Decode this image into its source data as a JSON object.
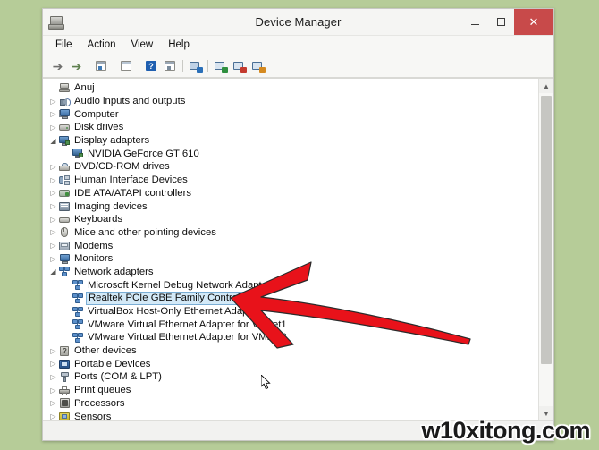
{
  "window": {
    "title": "Device Manager",
    "app_icon": "device-manager-icon",
    "minimize_label": "–",
    "maximize_label": "□",
    "close_label": "✕"
  },
  "menubar": {
    "items": [
      {
        "label": "File"
      },
      {
        "label": "Action"
      },
      {
        "label": "View"
      },
      {
        "label": "Help"
      }
    ]
  },
  "toolbar": {
    "buttons": [
      {
        "name": "back-button",
        "icon": "arrow-left-icon",
        "glyph": "←"
      },
      {
        "name": "forward-button",
        "icon": "arrow-right-icon",
        "glyph": "→"
      },
      {
        "name": "properties-button",
        "icon": "properties-window-icon",
        "glyph": ""
      },
      {
        "name": "help-topics-button",
        "icon": "document-icon",
        "glyph": ""
      },
      {
        "name": "help-button",
        "icon": "question-mark-icon",
        "glyph": "?"
      },
      {
        "name": "show-hidden-devices-button",
        "icon": "monitor-list-icon",
        "glyph": ""
      },
      {
        "name": "scan-hardware-changes-button",
        "icon": "scan-monitor-icon",
        "glyph": ""
      },
      {
        "name": "update-driver-button",
        "icon": "update-driver-icon",
        "glyph": ""
      },
      {
        "name": "uninstall-device-button",
        "icon": "uninstall-device-icon",
        "glyph": ""
      },
      {
        "name": "disable-device-button",
        "icon": "disable-device-icon",
        "glyph": ""
      }
    ]
  },
  "tree": {
    "root": {
      "label": "Anuj",
      "icon": "computer-root-icon",
      "expanded": true
    },
    "nodes": [
      {
        "label": "Audio inputs and outputs",
        "icon": "speaker-icon",
        "state": "collapsed",
        "depth": 1
      },
      {
        "label": "Computer",
        "icon": "computer-icon",
        "state": "collapsed",
        "depth": 1
      },
      {
        "label": "Disk drives",
        "icon": "disk-drive-icon",
        "state": "collapsed",
        "depth": 1
      },
      {
        "label": "Display adapters",
        "icon": "display-adapter-icon",
        "state": "expanded",
        "depth": 1
      },
      {
        "label": "NVIDIA GeForce GT 610",
        "icon": "display-adapter-icon",
        "state": "leaf",
        "depth": 2
      },
      {
        "label": "DVD/CD-ROM drives",
        "icon": "dvd-drive-icon",
        "state": "collapsed",
        "depth": 1
      },
      {
        "label": "Human Interface Devices",
        "icon": "hid-icon",
        "state": "collapsed",
        "depth": 1
      },
      {
        "label": "IDE ATA/ATAPI controllers",
        "icon": "ide-controller-icon",
        "state": "collapsed",
        "depth": 1
      },
      {
        "label": "Imaging devices",
        "icon": "imaging-device-icon",
        "state": "collapsed",
        "depth": 1
      },
      {
        "label": "Keyboards",
        "icon": "keyboard-icon",
        "state": "collapsed",
        "depth": 1
      },
      {
        "label": "Mice and other pointing devices",
        "icon": "mouse-icon",
        "state": "collapsed",
        "depth": 1
      },
      {
        "label": "Modems",
        "icon": "modem-icon",
        "state": "collapsed",
        "depth": 1
      },
      {
        "label": "Monitors",
        "icon": "monitor-icon",
        "state": "collapsed",
        "depth": 1
      },
      {
        "label": "Network adapters",
        "icon": "network-adapter-icon",
        "state": "expanded",
        "depth": 1
      },
      {
        "label": "Microsoft Kernel Debug Network Adapter",
        "icon": "network-adapter-icon",
        "state": "leaf",
        "depth": 2
      },
      {
        "label": "Realtek PCIe GBE Family Controller",
        "icon": "network-adapter-icon",
        "state": "leaf",
        "depth": 2,
        "selected": true
      },
      {
        "label": "VirtualBox Host-Only Ethernet Adapter",
        "icon": "network-adapter-icon",
        "state": "leaf",
        "depth": 2
      },
      {
        "label": "VMware Virtual Ethernet Adapter for VMnet1",
        "icon": "network-adapter-icon",
        "state": "leaf",
        "depth": 2
      },
      {
        "label": "VMware Virtual Ethernet Adapter for VMnet8",
        "icon": "network-adapter-icon",
        "state": "leaf",
        "depth": 2
      },
      {
        "label": "Other devices",
        "icon": "other-device-icon",
        "state": "collapsed",
        "depth": 1
      },
      {
        "label": "Portable Devices",
        "icon": "portable-device-icon",
        "state": "collapsed",
        "depth": 1
      },
      {
        "label": "Ports (COM & LPT)",
        "icon": "port-icon",
        "state": "collapsed",
        "depth": 1
      },
      {
        "label": "Print queues",
        "icon": "printer-icon",
        "state": "collapsed",
        "depth": 1
      },
      {
        "label": "Processors",
        "icon": "processor-icon",
        "state": "collapsed",
        "depth": 1
      },
      {
        "label": "Sensors",
        "icon": "sensor-icon",
        "state": "collapsed",
        "depth": 1
      }
    ],
    "expander_collapsed": "▷",
    "expander_expanded": "◢"
  },
  "scrollbar": {
    "up_arrow": "▲",
    "down_arrow": "▼"
  },
  "annotation": {
    "arrow_color": "#e8121a",
    "arrow_name": "red-pointer-arrow"
  },
  "watermark": {
    "text": "w10xitong.com"
  },
  "colors": {
    "desktop_background": "#b6cc98",
    "window_background": "#f4f4f2",
    "close_button": "#c84a4a",
    "selection_fill": "#d3e9f7",
    "selection_border": "#7aadd4"
  }
}
